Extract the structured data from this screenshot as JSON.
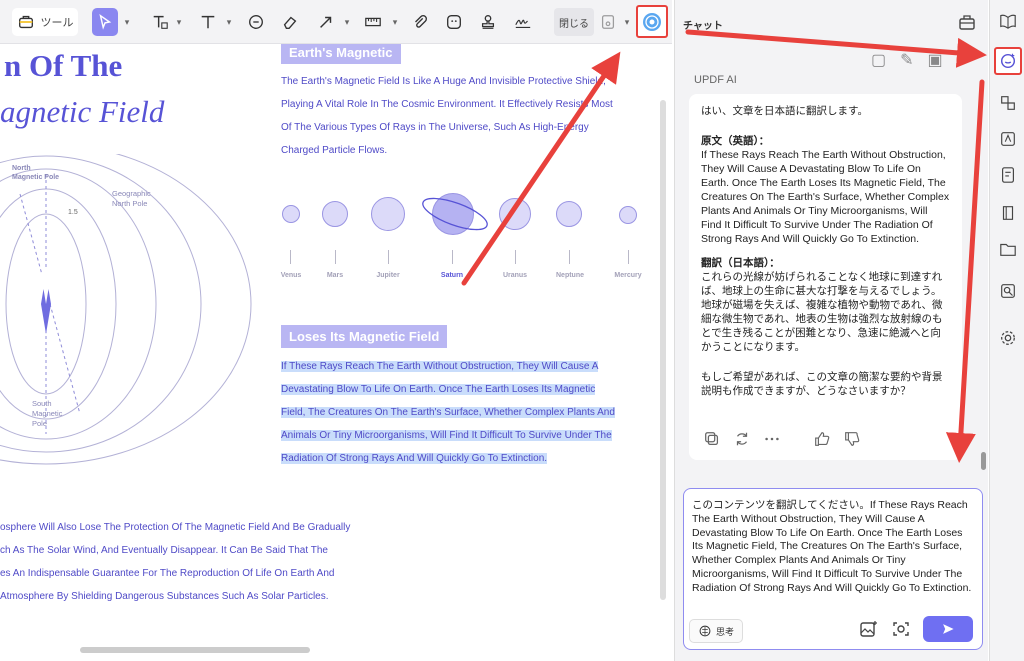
{
  "toolbar": {
    "tools_label": "ツール",
    "close_label": "閉じる"
  },
  "document": {
    "title_line1": "n Of The",
    "title_line2": "agnetic Field",
    "diagram": {
      "north_magnetic": "North\nMagnetic Pole",
      "geographic_north": "Geographic\nNorth Pole",
      "angle": "1.5",
      "south_magnetic": "South\nMagnetic\nPole"
    },
    "heading1": "Earth's Magnetic",
    "para1": [
      "The Earth's Magnetic Field Is Like A Huge And Invisible Protective Shield,",
      "Playing A Vital Role In The Cosmic Environment. It Effectively Resists Most",
      "Of The Various Types Of Rays in The Universe, Such As High-Energy",
      "Charged Particle Flows."
    ],
    "planets": [
      "Venus",
      "Mars",
      "Jupiter",
      "Saturn",
      "Uranus",
      "Neptune",
      "Mercury"
    ],
    "heading2": "Loses Its Magnetic Field",
    "para2": [
      "If These Rays Reach The Earth Without Obstruction, They Will Cause A",
      "Devastating Blow To Life On Earth. Once The Earth Loses Its Magnetic",
      "Field, The Creatures On The Earth's Surface, Whether Complex Plants And",
      "Animals Or Tiny Microorganisms, Will Find It Difficult To Survive Under The",
      "Radiation Of Strong Rays And Will Quickly Go To Extinction."
    ],
    "para3": [
      "osphere Will Also Lose The Protection Of The Magnetic Field And Be Gradually",
      "ch As The Solar Wind, And Eventually Disappear. It Can Be Said That The",
      "es An Indispensable Guarantee For The Reproduction Of Life On Earth And",
      " Atmosphere By Shielding Dangerous Substances Such As Solar Particles."
    ]
  },
  "chat": {
    "title": "チャット",
    "ai_label": "UPDF AI",
    "reply": {
      "intro": "はい、文章を日本語に翻訳します。",
      "original_heading": "原文（英語）：",
      "original_text": "If These Rays Reach The Earth Without Obstruction, They Will Cause A Devastating Blow To Life On Earth. Once The Earth Loses Its Magnetic Field, The Creatures On The Earth's Surface, Whether Complex Plants And Animals Or Tiny Microorganisms, Will Find It Difficult To Survive Under The Radiation Of Strong Rays And Will Quickly Go To Extinction.",
      "translation_heading": "翻訳（日本語）：",
      "translation_text": "これらの光線が妨げられることなく地球に到達すれば、地球上の生命に甚大な打撃を与えるでしょう。地球が磁場を失えば、複雑な植物や動物であれ、微細な微生物であれ、地表の生物は強烈な放射線のもとで生き残ることが困難となり、急速に絶滅へと向かうことになります。",
      "followup": "もしご希望があれば、この文章の簡潔な要約や背景説明も作成できますが、どうなさいますか？"
    },
    "input_text": "このコンテンツを翻訳してください。If These Rays Reach The Earth Without Obstruction, They Will Cause A Devastating Blow To Life On Earth. Once The Earth Loses Its Magnetic Field, The Creatures On The Earth's Surface, Whether Complex Plants And Animals Or Tiny Microorganisms, Will Find It Difficult To Survive Under The Radiation Of Strong Rays And Will Quickly Go To Extinction.",
    "think_label": "思考"
  },
  "colors": {
    "accent": "#5753d6",
    "highlight": "#c9ddfb",
    "annotation_red": "#e8413c",
    "send_button": "#6f6ff2"
  }
}
